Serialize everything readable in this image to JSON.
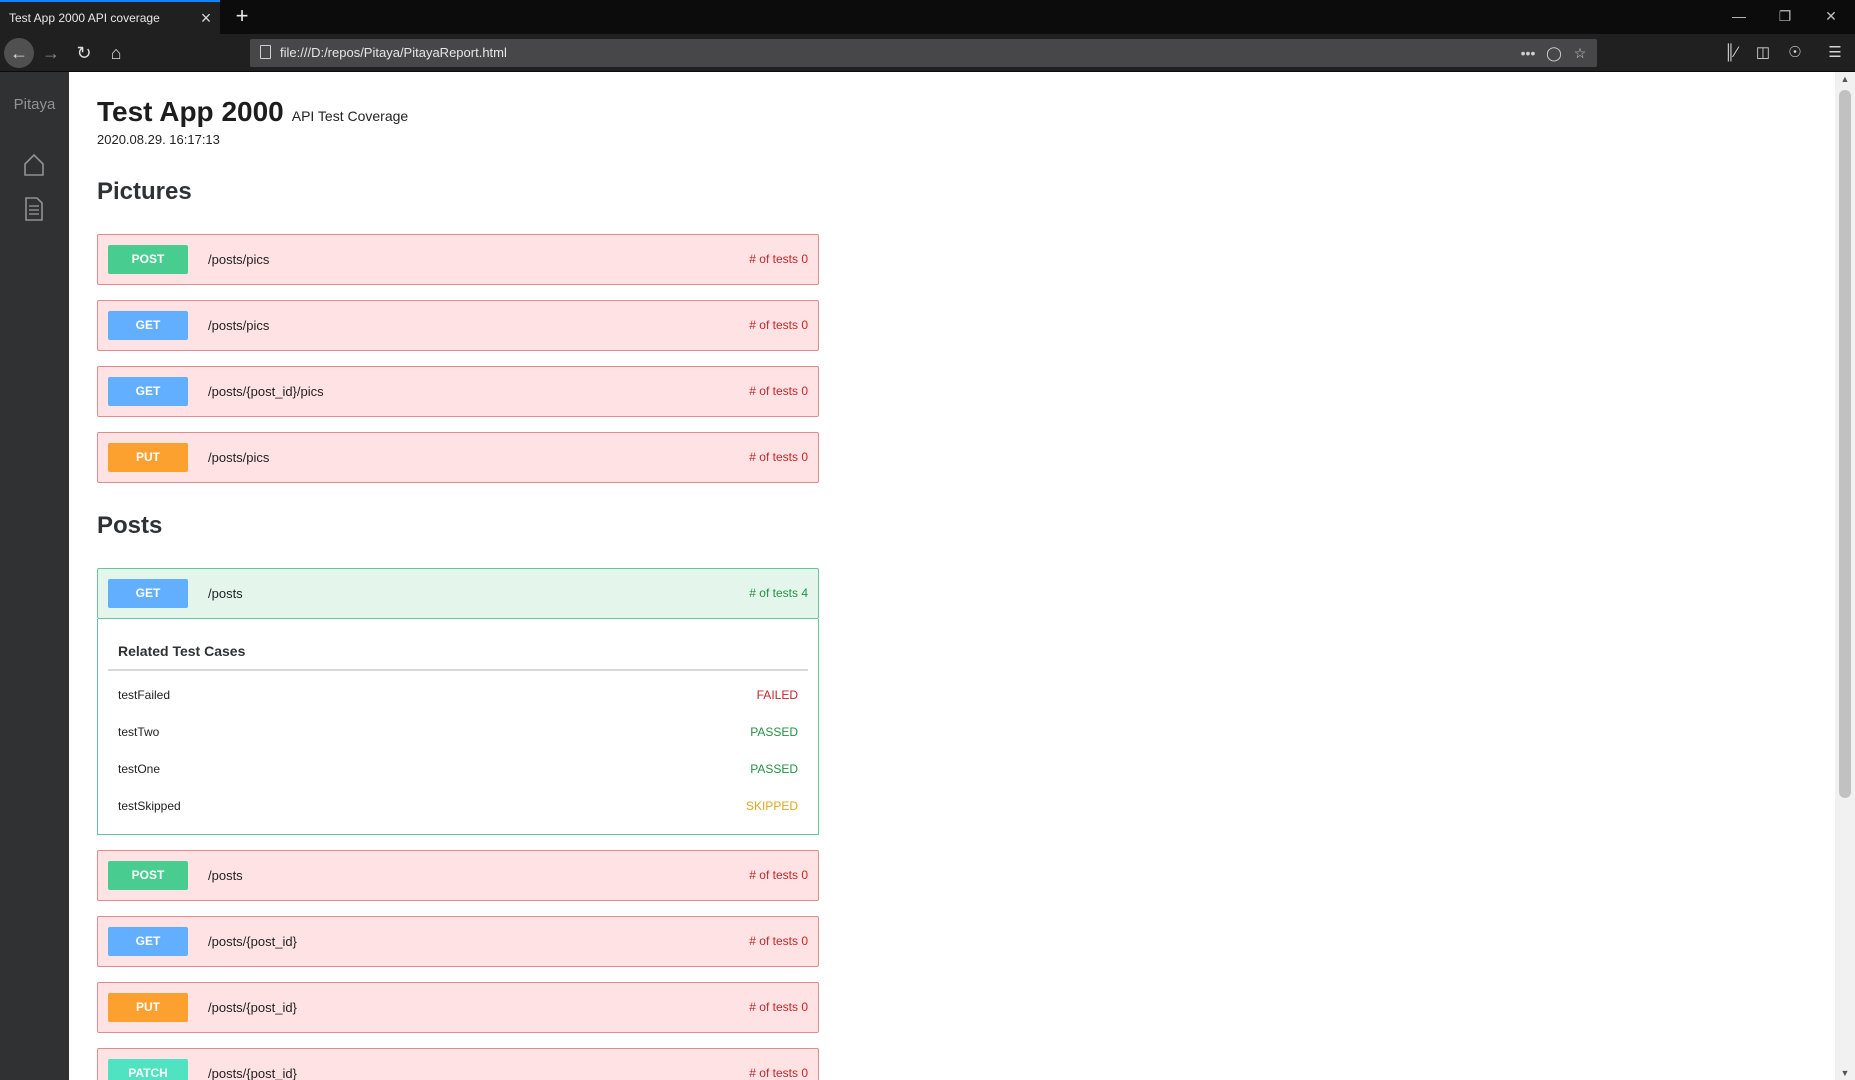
{
  "browser": {
    "tab_title": "Test App 2000 API coverage",
    "url": "file:///D:/repos/Pitaya/PitayaReport.html",
    "icons": [
      "back-icon",
      "forward-icon",
      "reload-icon",
      "home-icon",
      "page-icon",
      "more-icon",
      "pocket-icon",
      "bookmark-star-icon",
      "library-icon",
      "sidebar-icon",
      "account-icon",
      "menu-icon"
    ],
    "accent_color": "#0a84ff"
  },
  "sidebar": {
    "brand": "Pitaya",
    "icons": [
      "home-icon",
      "document-icon"
    ]
  },
  "report": {
    "app_name": "Test App 2000",
    "subtitle": "API Test Coverage",
    "timestamp": "2020.08.29. 16:17:13"
  },
  "sections": [
    {
      "title": "Pictures",
      "endpoints": [
        {
          "method": "POST",
          "path": "/posts/pics",
          "tests": "# of tests 0",
          "covered": false
        },
        {
          "method": "GET",
          "path": "/posts/pics",
          "tests": "# of tests 0",
          "covered": false
        },
        {
          "method": "GET",
          "path": "/posts/{post_id}/pics",
          "tests": "# of tests 0",
          "covered": false
        },
        {
          "method": "PUT",
          "path": "/posts/pics",
          "tests": "# of tests 0",
          "covered": false
        }
      ]
    },
    {
      "title": "Posts",
      "endpoints": [
        {
          "method": "GET",
          "path": "/posts",
          "tests": "# of tests 4",
          "covered": true,
          "related": {
            "title": "Related Test Cases",
            "cases": [
              {
                "name": "testFailed",
                "status": "FAILED"
              },
              {
                "name": "testTwo",
                "status": "PASSED"
              },
              {
                "name": "testOne",
                "status": "PASSED"
              },
              {
                "name": "testSkipped",
                "status": "SKIPPED"
              }
            ]
          }
        },
        {
          "method": "POST",
          "path": "/posts",
          "tests": "# of tests 0",
          "covered": false
        },
        {
          "method": "GET",
          "path": "/posts/{post_id}",
          "tests": "# of tests 0",
          "covered": false
        },
        {
          "method": "PUT",
          "path": "/posts/{post_id}",
          "tests": "# of tests 0",
          "covered": false
        },
        {
          "method": "PATCH",
          "path": "/posts/{post_id}",
          "tests": "# of tests 0",
          "covered": false
        }
      ]
    }
  ],
  "colors": {
    "post": "#49cc90",
    "get": "#61affe",
    "put": "#fca130",
    "patch": "#50e3c2",
    "uncovered_bg": "#ffe2e3",
    "covered_bg": "#e4f6ec",
    "failed": "#c3262b",
    "passed": "#239143",
    "skipped": "#e0a61e"
  }
}
